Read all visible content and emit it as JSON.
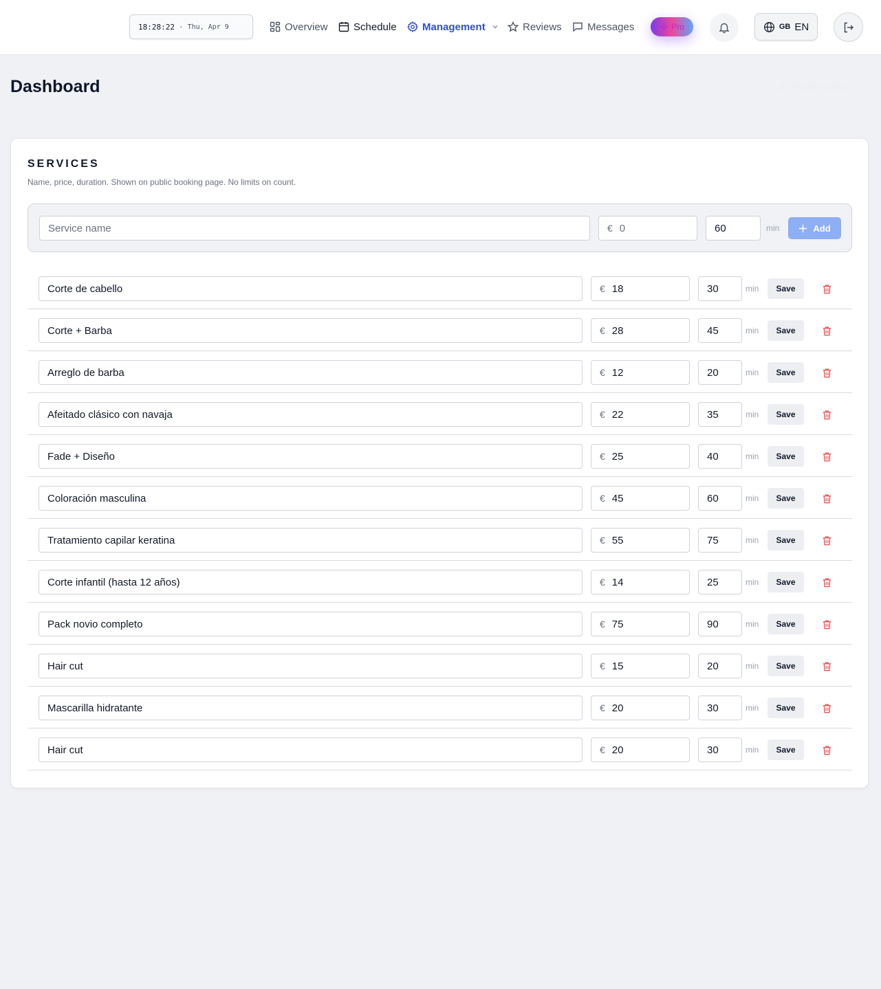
{
  "header": {
    "clock_time": "18:28:22",
    "clock_sep": "·",
    "clock_date": "Thu, Apr 9",
    "nav": [
      {
        "label": "Overview",
        "icon": "grid-icon"
      },
      {
        "label": "Schedule",
        "icon": "calendar-icon"
      },
      {
        "label": "Management",
        "icon": "gear-icon"
      },
      {
        "label": "Reviews",
        "icon": "star-icon"
      },
      {
        "label": "Messages",
        "icon": "message-icon"
      }
    ],
    "pro_label": "Pro",
    "lang_flag": "GB",
    "lang_code": "EN"
  },
  "page": {
    "title": "Dashboard",
    "profile_settings": "Profile settings"
  },
  "services": {
    "title": "SERVICES",
    "subtitle": "Name, price, duration. Shown on public booking page. No limits on count.",
    "new_service": {
      "name_placeholder": "Service name",
      "currency": "€",
      "price_placeholder": "0",
      "duration": "60",
      "unit": "min",
      "add_label": "Add"
    },
    "save_label": "Save",
    "unit": "min",
    "currency": "€",
    "items": [
      {
        "name": "Corte de cabello",
        "price": "18",
        "duration": "30"
      },
      {
        "name": "Corte + Barba",
        "price": "28",
        "duration": "45"
      },
      {
        "name": "Arreglo de barba",
        "price": "12",
        "duration": "20"
      },
      {
        "name": "Afeitado clásico con navaja",
        "price": "22",
        "duration": "35"
      },
      {
        "name": "Fade + Diseño",
        "price": "25",
        "duration": "40"
      },
      {
        "name": "Coloración masculina",
        "price": "45",
        "duration": "60"
      },
      {
        "name": "Tratamiento capilar keratina",
        "price": "55",
        "duration": "75"
      },
      {
        "name": "Corte infantil (hasta 12 años)",
        "price": "14",
        "duration": "25"
      },
      {
        "name": "Pack novio completo",
        "price": "75",
        "duration": "90"
      },
      {
        "name": "Hair cut",
        "price": "15",
        "duration": "20"
      },
      {
        "name": "Mascarilla hidratante",
        "price": "20",
        "duration": "30"
      },
      {
        "name": "Hair cut",
        "price": "20",
        "duration": "30"
      }
    ]
  },
  "colors": {
    "accent": "#2f4fd8",
    "add_button": "#8eaef5",
    "danger": "#ef4444"
  }
}
